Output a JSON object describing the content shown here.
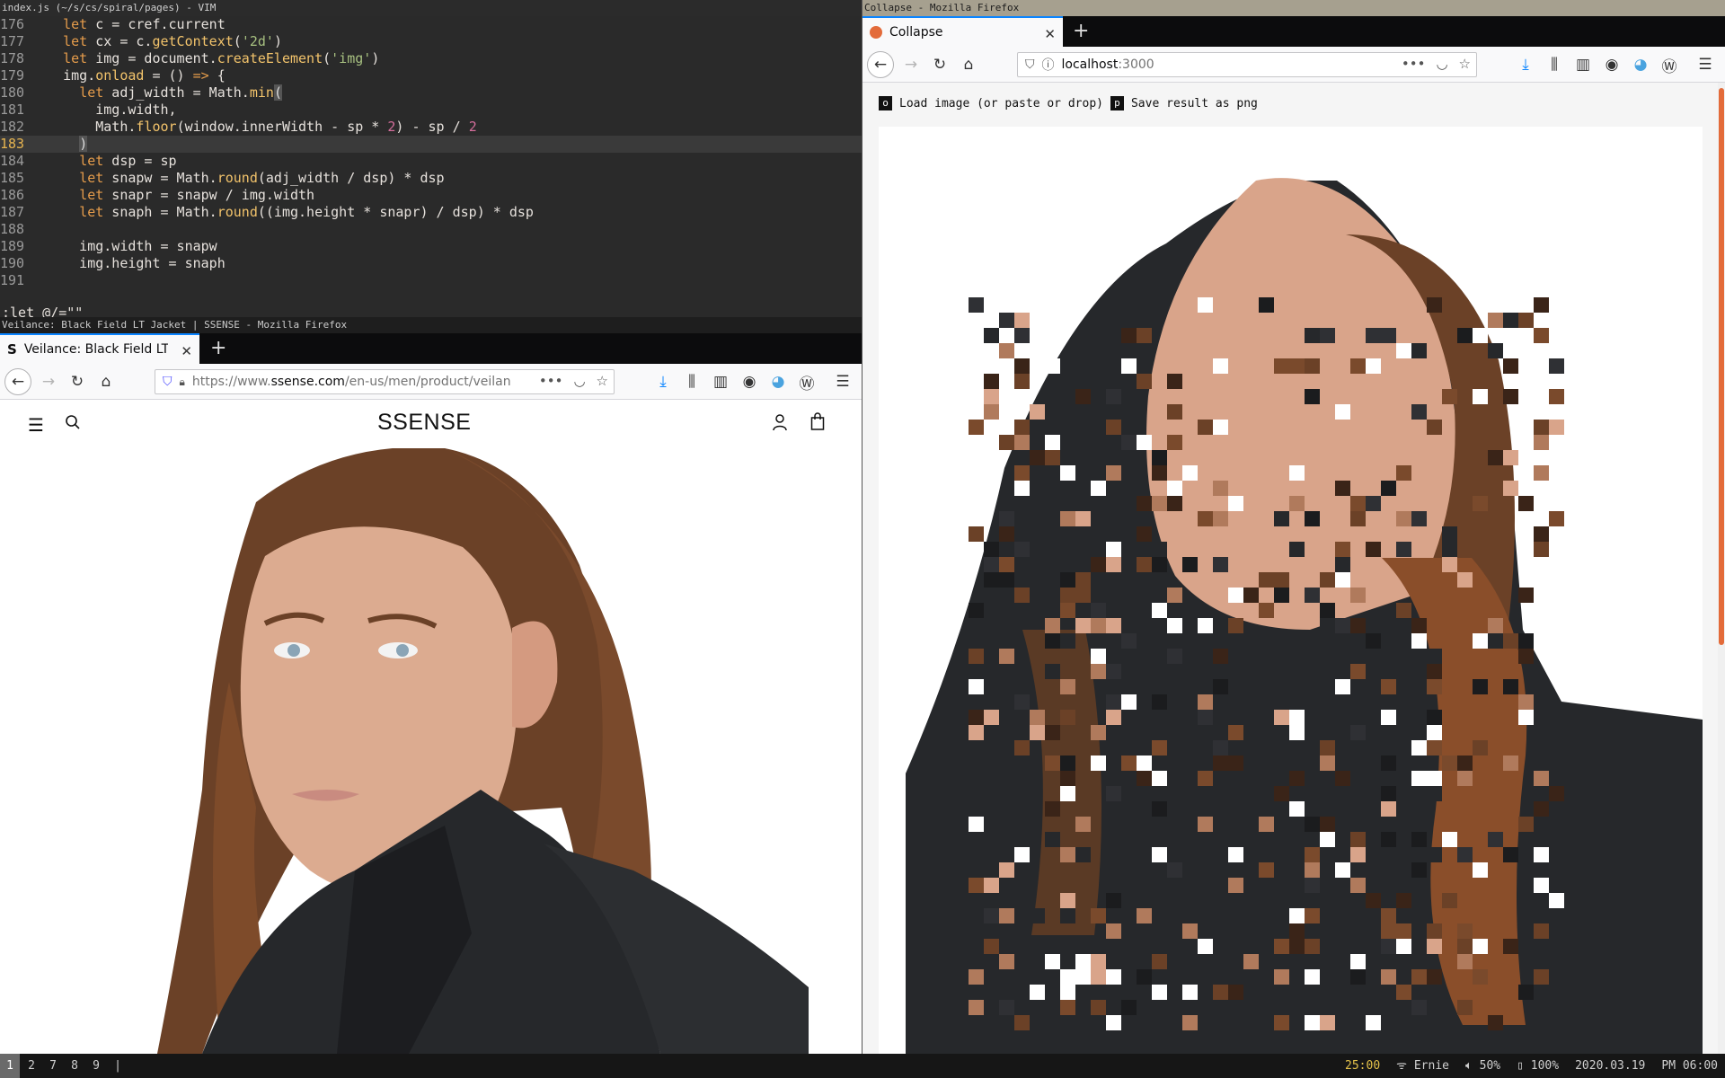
{
  "vim": {
    "window_title": "index.js (~/s/cs/spiral/pages) - VIM",
    "command_line": ":let @/=\"\"",
    "lines": [
      {
        "n": "176",
        "cur": false,
        "parts": [
          [
            "",
            "    "
          ],
          [
            "kw",
            "let"
          ],
          [
            "",
            " c = cref.current"
          ]
        ]
      },
      {
        "n": "177",
        "cur": false,
        "parts": [
          [
            "",
            "    "
          ],
          [
            "kw",
            "let"
          ],
          [
            "",
            " cx = c."
          ],
          [
            "fn",
            "getContext"
          ],
          [
            "",
            "("
          ],
          [
            "str",
            "'2d'"
          ],
          [
            "",
            ")"
          ]
        ]
      },
      {
        "n": "178",
        "cur": false,
        "parts": [
          [
            "",
            "    "
          ],
          [
            "kw",
            "let"
          ],
          [
            "",
            " img = document."
          ],
          [
            "fn",
            "createElement"
          ],
          [
            "",
            "("
          ],
          [
            "str",
            "'img'"
          ],
          [
            "",
            ")"
          ]
        ]
      },
      {
        "n": "179",
        "cur": false,
        "parts": [
          [
            "",
            "    img."
          ],
          [
            "fn",
            "onload"
          ],
          [
            "",
            " = () "
          ],
          [
            "kw",
            "=>"
          ],
          [
            "",
            " {"
          ]
        ]
      },
      {
        "n": "180",
        "cur": false,
        "parts": [
          [
            "",
            "      "
          ],
          [
            "kw",
            "let"
          ],
          [
            "",
            " adj_width = Math."
          ],
          [
            "fn",
            "min"
          ],
          [
            "cursor",
            "("
          ]
        ]
      },
      {
        "n": "181",
        "cur": false,
        "parts": [
          [
            "",
            "        img.width,"
          ]
        ]
      },
      {
        "n": "182",
        "cur": false,
        "parts": [
          [
            "",
            "        Math."
          ],
          [
            "fn",
            "floor"
          ],
          [
            "",
            "(window.innerWidth - sp * "
          ],
          [
            "num",
            "2"
          ],
          [
            "",
            ") - sp / "
          ],
          [
            "num",
            "2"
          ]
        ]
      },
      {
        "n": "183",
        "cur": true,
        "parts": [
          [
            "",
            "      "
          ],
          [
            "cursor",
            ")"
          ]
        ]
      },
      {
        "n": "184",
        "cur": false,
        "parts": [
          [
            "",
            "      "
          ],
          [
            "kw",
            "let"
          ],
          [
            "",
            " dsp = sp"
          ]
        ]
      },
      {
        "n": "185",
        "cur": false,
        "parts": [
          [
            "",
            "      "
          ],
          [
            "kw",
            "let"
          ],
          [
            "",
            " snapw = Math."
          ],
          [
            "fn",
            "round"
          ],
          [
            "",
            "(adj_width / dsp) * dsp"
          ]
        ]
      },
      {
        "n": "186",
        "cur": false,
        "parts": [
          [
            "",
            "      "
          ],
          [
            "kw",
            "let"
          ],
          [
            "",
            " snapr = snapw / img.width"
          ]
        ]
      },
      {
        "n": "187",
        "cur": false,
        "parts": [
          [
            "",
            "      "
          ],
          [
            "kw",
            "let"
          ],
          [
            "",
            " snaph = Math."
          ],
          [
            "fn",
            "round"
          ],
          [
            "",
            "((img.height * snapr) / dsp) * dsp"
          ]
        ]
      },
      {
        "n": "188",
        "cur": false,
        "parts": [
          [
            "",
            ""
          ]
        ]
      },
      {
        "n": "189",
        "cur": false,
        "parts": [
          [
            "",
            "      img.width = snapw"
          ]
        ]
      },
      {
        "n": "190",
        "cur": false,
        "parts": [
          [
            "",
            "      img.height = snaph"
          ]
        ]
      },
      {
        "n": "191",
        "cur": false,
        "parts": [
          [
            "",
            ""
          ]
        ]
      }
    ]
  },
  "ssense": {
    "window_title": "Veilance: Black Field LT Jacket | SSENSE - Mozilla Firefox",
    "tab_label": "Veilance: Black Field LT J",
    "tab_favicon": "S",
    "url_prefix": "https://www.",
    "url_domain": "ssense.com",
    "url_path": "/en-us/men/product/veilan",
    "logo": "SSENSE"
  },
  "collapse": {
    "window_title": "Collapse - Mozilla Firefox",
    "tab_label": "Collapse",
    "url_host": "localhost",
    "url_port": ":3000",
    "load_key": "o",
    "load_label": "Load image (or paste or drop)",
    "save_key": "p",
    "save_label": "Save result as png"
  },
  "statusbar": {
    "workspaces": [
      "1",
      "2",
      "7",
      "8",
      "9"
    ],
    "active_workspace": "1",
    "separator": "|",
    "time_left": "25:00",
    "wifi": "Ernie",
    "volume": "50%",
    "battery": "100%",
    "date": "2020.03.19",
    "clock": "PM 06:00"
  },
  "colors": {
    "accent": "#0a84ff",
    "scroll_thumb": "#e36b3a",
    "jacket": "#26282b",
    "hair": "#6b4127",
    "skin": "#d9a48a"
  }
}
